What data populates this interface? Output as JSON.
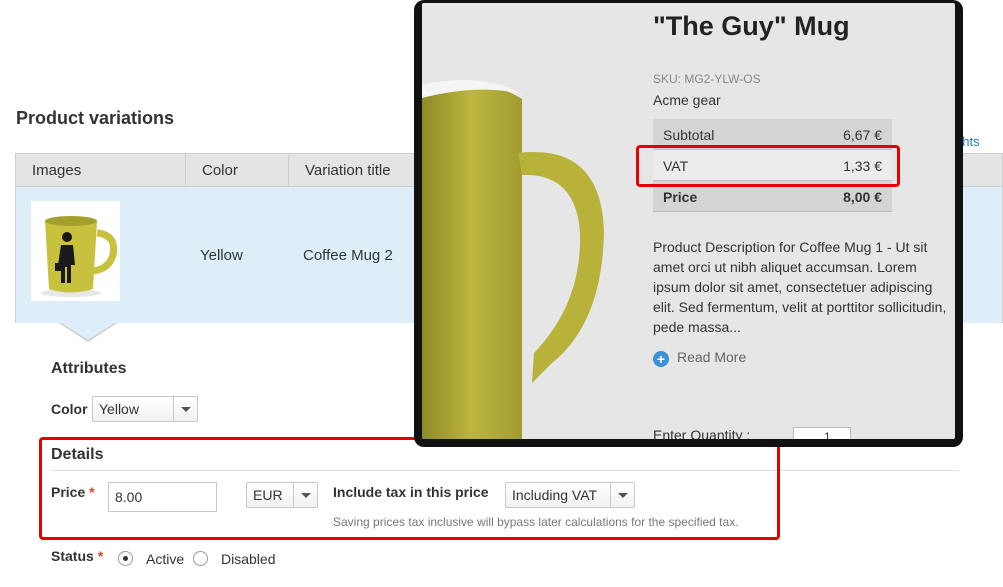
{
  "section_title": "Product variations",
  "right_link": "ghts",
  "table": {
    "headers": [
      "Images",
      "Color",
      "Variation title"
    ],
    "row": {
      "color": "Yellow",
      "title": "Coffee Mug 2"
    }
  },
  "attributes": {
    "heading": "Attributes",
    "color_label": "Color",
    "color_value": "Yellow"
  },
  "details": {
    "heading": "Details",
    "price_label": "Price",
    "required_mark": "*",
    "price_value": "8.00",
    "currency": "EUR",
    "tax_label": "Include tax in this price",
    "tax_value": "Including VAT",
    "hint": "Saving prices tax inclusive will bypass later calculations for the specified tax."
  },
  "status": {
    "label": "Status",
    "required_mark": "*",
    "options": [
      "Active",
      "Disabled"
    ],
    "selected": "Active"
  },
  "popup": {
    "title": "\"The Guy\" Mug",
    "sku": "SKU: MG2-YLW-OS",
    "brand": "Acme gear",
    "rows": [
      {
        "label": "Subtotal",
        "value": "6,67 €"
      },
      {
        "label": "VAT",
        "value": "1,33 €"
      },
      {
        "label": "Price",
        "value": "8,00 €"
      }
    ],
    "description": "Product Description for Coffee Mug 1 - Ut sit amet orci ut nibh aliquet accumsan. Lorem ipsum dolor sit amet, consectetuer adipiscing elit. Sed fermentum, velit at porttitor sollicitudin, pede massa...",
    "read_more": "Read More",
    "quantity_label": "Enter Quantity :",
    "quantity_value": "1"
  },
  "colors": {
    "highlight": "#e60000",
    "row_bg": "#ddeef9",
    "mug": "#b8b23a",
    "link": "#1f7bc1"
  },
  "icons": [
    "plus-circle-icon",
    "chevron-down-icon",
    "radio-icon"
  ]
}
